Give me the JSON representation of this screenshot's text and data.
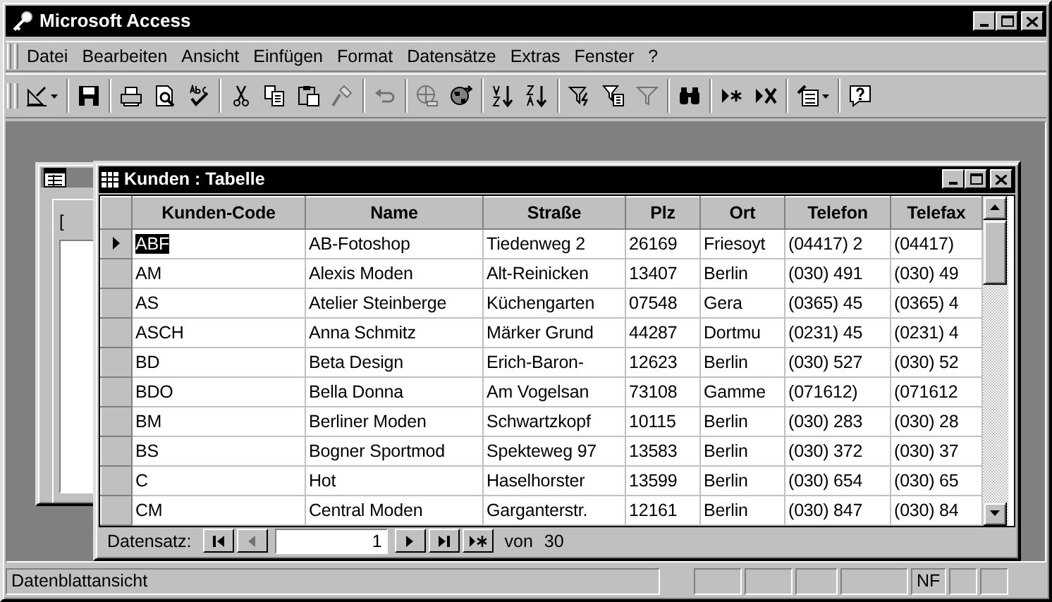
{
  "window": {
    "title": "Microsoft Access"
  },
  "menu": [
    "Datei",
    "Bearbeiten",
    "Ansicht",
    "Einfügen",
    "Format",
    "Datensätze",
    "Extras",
    "Fenster",
    "?"
  ],
  "toolbar": [
    {
      "kind": "view",
      "disabled": false,
      "dropdown": true
    },
    {
      "kind": "save",
      "disabled": false,
      "group_start": true
    },
    {
      "kind": "print",
      "disabled": false,
      "group_start": true
    },
    {
      "kind": "preview",
      "disabled": false
    },
    {
      "kind": "spelling",
      "disabled": false
    },
    {
      "kind": "cut",
      "disabled": false,
      "group_start": true
    },
    {
      "kind": "copy",
      "disabled": false
    },
    {
      "kind": "paste",
      "disabled": false
    },
    {
      "kind": "brush",
      "disabled": true
    },
    {
      "kind": "undo",
      "disabled": true,
      "group_start": true
    },
    {
      "kind": "globe",
      "disabled": true,
      "group_start": true
    },
    {
      "kind": "globe-arrow",
      "disabled": false
    },
    {
      "kind": "sort-asc",
      "disabled": false,
      "group_start": true
    },
    {
      "kind": "sort-desc",
      "disabled": false
    },
    {
      "kind": "filter-lightning",
      "disabled": false,
      "group_start": true
    },
    {
      "kind": "filter-form",
      "disabled": false
    },
    {
      "kind": "filter",
      "disabled": true
    },
    {
      "kind": "find",
      "disabled": false,
      "group_start": true
    },
    {
      "kind": "new-record",
      "disabled": false,
      "group_start": true
    },
    {
      "kind": "delete-record",
      "disabled": false
    },
    {
      "kind": "new-object",
      "disabled": false,
      "dropdown": true,
      "group_start": true
    },
    {
      "kind": "help",
      "disabled": false,
      "group_start": true
    }
  ],
  "database_window": {
    "fragment": "["
  },
  "table_window": {
    "title": "Kunden : Tabelle",
    "columns": [
      "Kunden-Code",
      "Name",
      "Straße",
      "Plz",
      "Ort",
      "Telefon",
      "Telefax"
    ],
    "rows": [
      {
        "selected": true,
        "cells": [
          "ABF",
          "AB-Fotoshop",
          "Tiedenweg 2",
          "26169",
          "Friesoyt",
          "(04417) 2",
          "(04417)"
        ]
      },
      {
        "selected": false,
        "cells": [
          "AM",
          "Alexis Moden",
          "Alt-Reinicken",
          "13407",
          "Berlin",
          "(030) 491",
          "(030) 49"
        ]
      },
      {
        "selected": false,
        "cells": [
          "AS",
          "Atelier Steinberge",
          "Küchengarten",
          "07548",
          "Gera",
          "(0365) 45",
          "(0365) 4"
        ]
      },
      {
        "selected": false,
        "cells": [
          "ASCH",
          "Anna Schmitz",
          "Märker Grund",
          "44287",
          "Dortmu",
          "(0231) 45",
          "(0231) 4"
        ]
      },
      {
        "selected": false,
        "cells": [
          "BD",
          "Beta Design",
          "Erich-Baron-",
          "12623",
          "Berlin",
          "(030) 527",
          "(030) 52"
        ]
      },
      {
        "selected": false,
        "cells": [
          "BDO",
          "Bella Donna",
          "Am Vogelsan",
          "73108",
          "Gamme",
          "(071612)",
          "(071612"
        ]
      },
      {
        "selected": false,
        "cells": [
          "BM",
          "Berliner Moden",
          "Schwartzkopf",
          "10115",
          "Berlin",
          "(030) 283",
          "(030) 28"
        ]
      },
      {
        "selected": false,
        "cells": [
          "BS",
          "Bogner Sportmod",
          "Spekteweg 97",
          "13583",
          "Berlin",
          "(030) 372",
          "(030) 37"
        ]
      },
      {
        "selected": false,
        "cells": [
          "C",
          "Hot",
          "Haselhorster",
          "13599",
          "Berlin",
          "(030) 654",
          "(030) 65"
        ]
      },
      {
        "selected": false,
        "cells": [
          "CM",
          "Central Moden",
          "Garganterstr.",
          "12161",
          "Berlin",
          "(030) 847",
          "(030) 84"
        ]
      }
    ],
    "navigator": {
      "label": "Datensatz:",
      "record": "1",
      "of_label": "von",
      "total": "30",
      "first_disabled": false,
      "prev_disabled": true
    }
  },
  "status_bar": {
    "text": "Datenblattansicht",
    "indicator": "NF"
  }
}
